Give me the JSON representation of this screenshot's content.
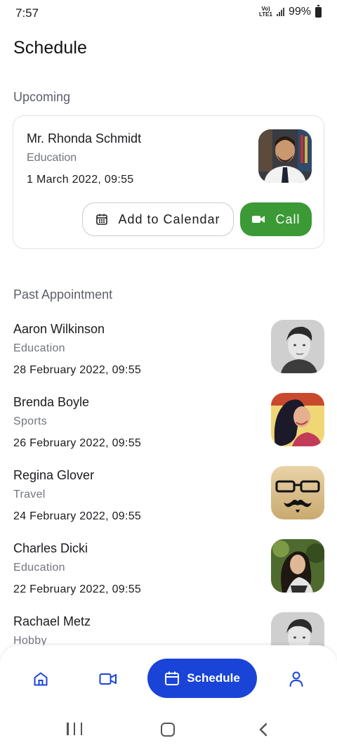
{
  "status_bar": {
    "time": "7:57",
    "network": "Vo) LTE1",
    "battery": "99%"
  },
  "page_title": "Schedule",
  "upcoming": {
    "section_title": "Upcoming",
    "name": "Mr. Rhonda Schmidt",
    "category": "Education",
    "datetime": "1 March 2022, 09:55",
    "add_to_calendar_label": "Add to Calendar",
    "call_label": "Call",
    "call_color": "#3b9a36"
  },
  "past": {
    "section_title": "Past Appointment",
    "items": [
      {
        "name": "Aaron Wilkinson",
        "category": "Education",
        "datetime": "28 February 2022, 09:55"
      },
      {
        "name": "Brenda Boyle",
        "category": "Sports",
        "datetime": "26 February 2022, 09:55"
      },
      {
        "name": "Regina Glover",
        "category": "Travel",
        "datetime": "24 February 2022, 09:55"
      },
      {
        "name": "Charles Dicki",
        "category": "Education",
        "datetime": "22 February 2022, 09:55"
      },
      {
        "name": "Rachael Metz",
        "category": "Hobby",
        "datetime": ""
      }
    ]
  },
  "bottom_nav": {
    "active_label": "Schedule",
    "accent": "#1a44d8",
    "icons": [
      "home-icon",
      "video-icon",
      "calendar-icon",
      "profile-icon"
    ]
  }
}
